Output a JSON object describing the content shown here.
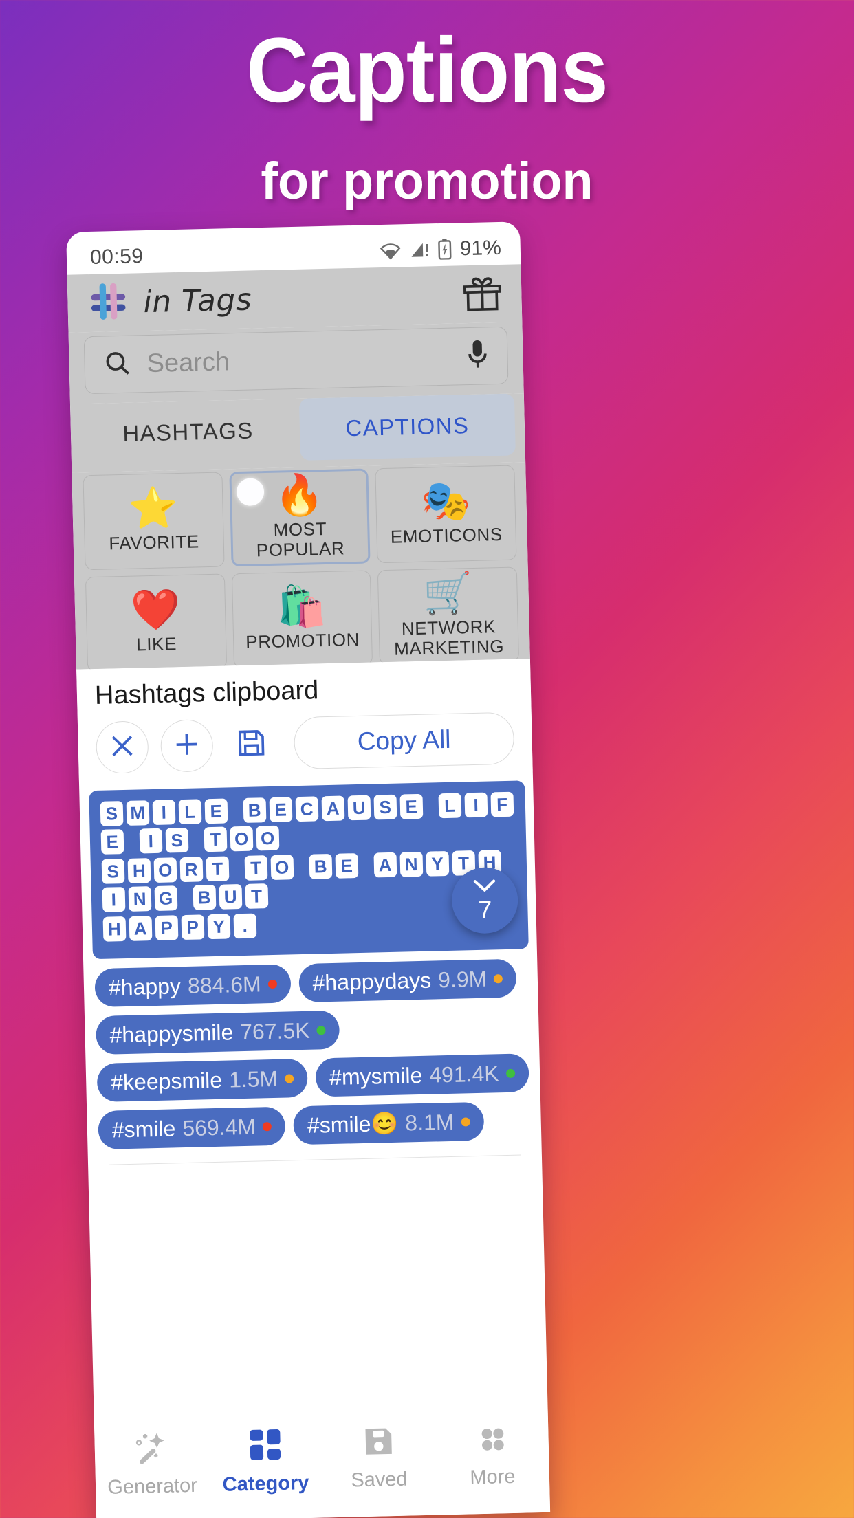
{
  "promo": {
    "title": "Captions",
    "subtitle": "for promotion"
  },
  "status_bar": {
    "time": "00:59",
    "battery": "91%",
    "icons": [
      "wifi-icon",
      "cellular-warning-icon",
      "battery-charging-icon"
    ]
  },
  "app_bar": {
    "logo_icon": "hashtag-logo-icon",
    "title": "in Tags",
    "gift_icon": "gift-icon"
  },
  "search": {
    "placeholder": "Search",
    "search_icon": "search-icon",
    "mic_icon": "microphone-icon"
  },
  "tabs": [
    {
      "label": "HASHTAGS",
      "active": false
    },
    {
      "label": "CAPTIONS",
      "active": true
    }
  ],
  "categories": [
    {
      "label": "FAVORITE",
      "icon": "star-icon",
      "glyph": "⭐",
      "selected": false
    },
    {
      "label": "MOST POPULAR",
      "icon": "fire-icon",
      "glyph": "🔥",
      "selected": true
    },
    {
      "label": "EMOTICONS",
      "icon": "masks-icon",
      "glyph": "🎭",
      "selected": false
    },
    {
      "label": "LIKE",
      "icon": "heart-hand-icon",
      "glyph": "❤️",
      "selected": false
    },
    {
      "label": "PROMOTION",
      "icon": "seo-bag-icon",
      "glyph": "🛍️",
      "selected": false
    },
    {
      "label": "NETWORK MARKETING",
      "icon": "shopping-cart-icon",
      "glyph": "🛒",
      "selected": false
    }
  ],
  "scroll_badge": {
    "count": "7",
    "icon": "chevron-down-icon"
  },
  "clipboard": {
    "title": "Hashtags clipboard",
    "clear_icon": "close-icon",
    "add_icon": "plus-icon",
    "save_icon": "floppy-save-icon",
    "copy_all_label": "Copy All"
  },
  "caption": {
    "lines": [
      "SMILE BECAUSE LIFE IS TOO",
      "SHORT TO BE ANYTHING BUT",
      "HAPPY."
    ]
  },
  "hashtags": [
    {
      "tag": "#happy",
      "count": "884.6M",
      "dot": "#f03b20"
    },
    {
      "tag": "#happydays",
      "count": "9.9M",
      "dot": "#f5a623"
    },
    {
      "tag": "#happysmile",
      "count": "767.5K",
      "dot": "#3fbf3f"
    },
    {
      "tag": "#keepsmile",
      "count": "1.5M",
      "dot": "#f5a623"
    },
    {
      "tag": "#mysmile",
      "count": "491.4K",
      "dot": "#3fbf3f"
    },
    {
      "tag": "#smile",
      "count": "569.4M",
      "dot": "#f03b20"
    },
    {
      "tag": "#smile😊",
      "count": "8.1M",
      "dot": "#f5a623"
    }
  ],
  "bottom_nav": [
    {
      "label": "Generator",
      "icon": "magic-wand-icon",
      "active": false
    },
    {
      "label": "Category",
      "icon": "grid-icon",
      "active": true
    },
    {
      "label": "Saved",
      "icon": "floppy-disk-icon",
      "active": false
    },
    {
      "label": "More",
      "icon": "more-dots-icon",
      "active": false
    }
  ],
  "colors": {
    "accent": "#4a6cc0",
    "tab_active_text": "#2f55c9",
    "app_bar_bg": "#c9c9c9"
  }
}
